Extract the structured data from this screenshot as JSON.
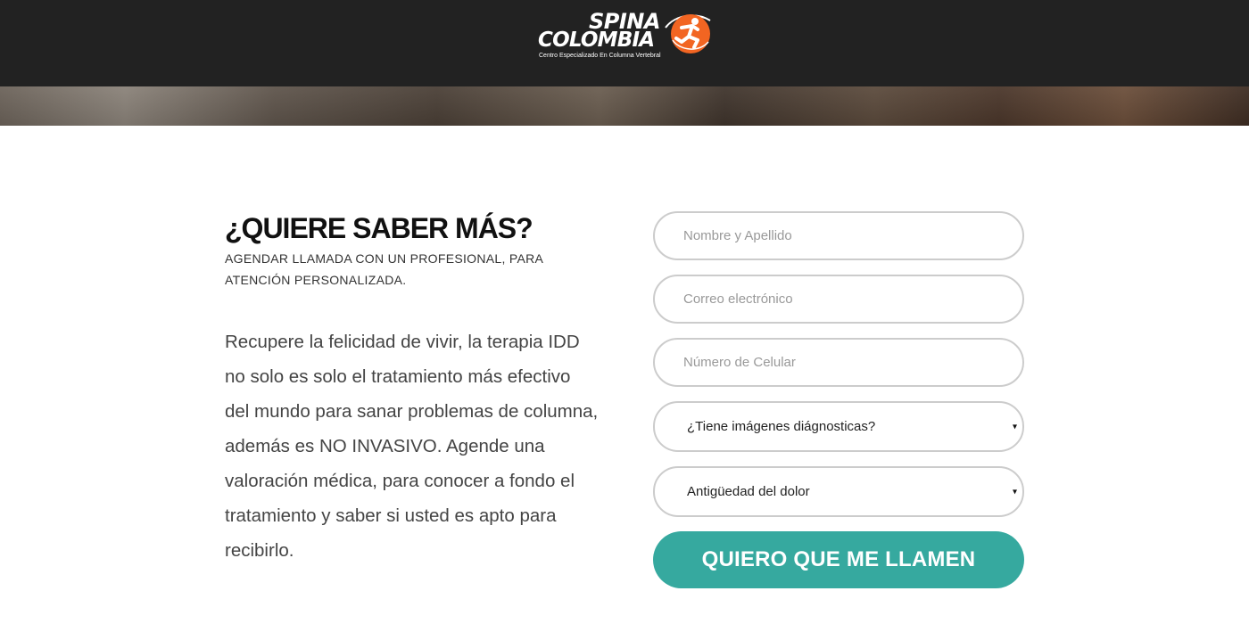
{
  "brand": {
    "name_line1": "SPINA",
    "name_line2": "COLOMBIA",
    "tagline": "Centro Especializado En Columna Vertebral",
    "logo_icon": "runner-in-orange-circle-icon",
    "logo_color": "#f26522"
  },
  "section": {
    "heading": "¿QUIERE SABER MÁS?",
    "subheading": "AGENDAR LLAMADA CON UN PROFESIONAL, PARA ATENCIÓN PERSONALIZADA.",
    "body": "Recupere la felicidad de vivir, la terapia IDD no solo es solo el tratamiento más efectivo del mundo para sanar problemas de columna, además es NO INVASIVO. Agende una valoración médica, para conocer a fondo el tratamiento y saber si usted es apto para recibirlo."
  },
  "form": {
    "name_placeholder": "Nombre y Apellido",
    "email_placeholder": "Correo electrónico",
    "phone_placeholder": "Número de Celular",
    "imaging_select": "¿Tiene imágenes diágnosticas?",
    "pain_select": "Antigüedad del dolor",
    "submit_label": "QUIERO QUE ME LLAMEN",
    "caret_icon": "▾"
  },
  "colors": {
    "header_bg": "#222222",
    "button_bg": "#36a99f",
    "input_border": "#cccccc"
  }
}
